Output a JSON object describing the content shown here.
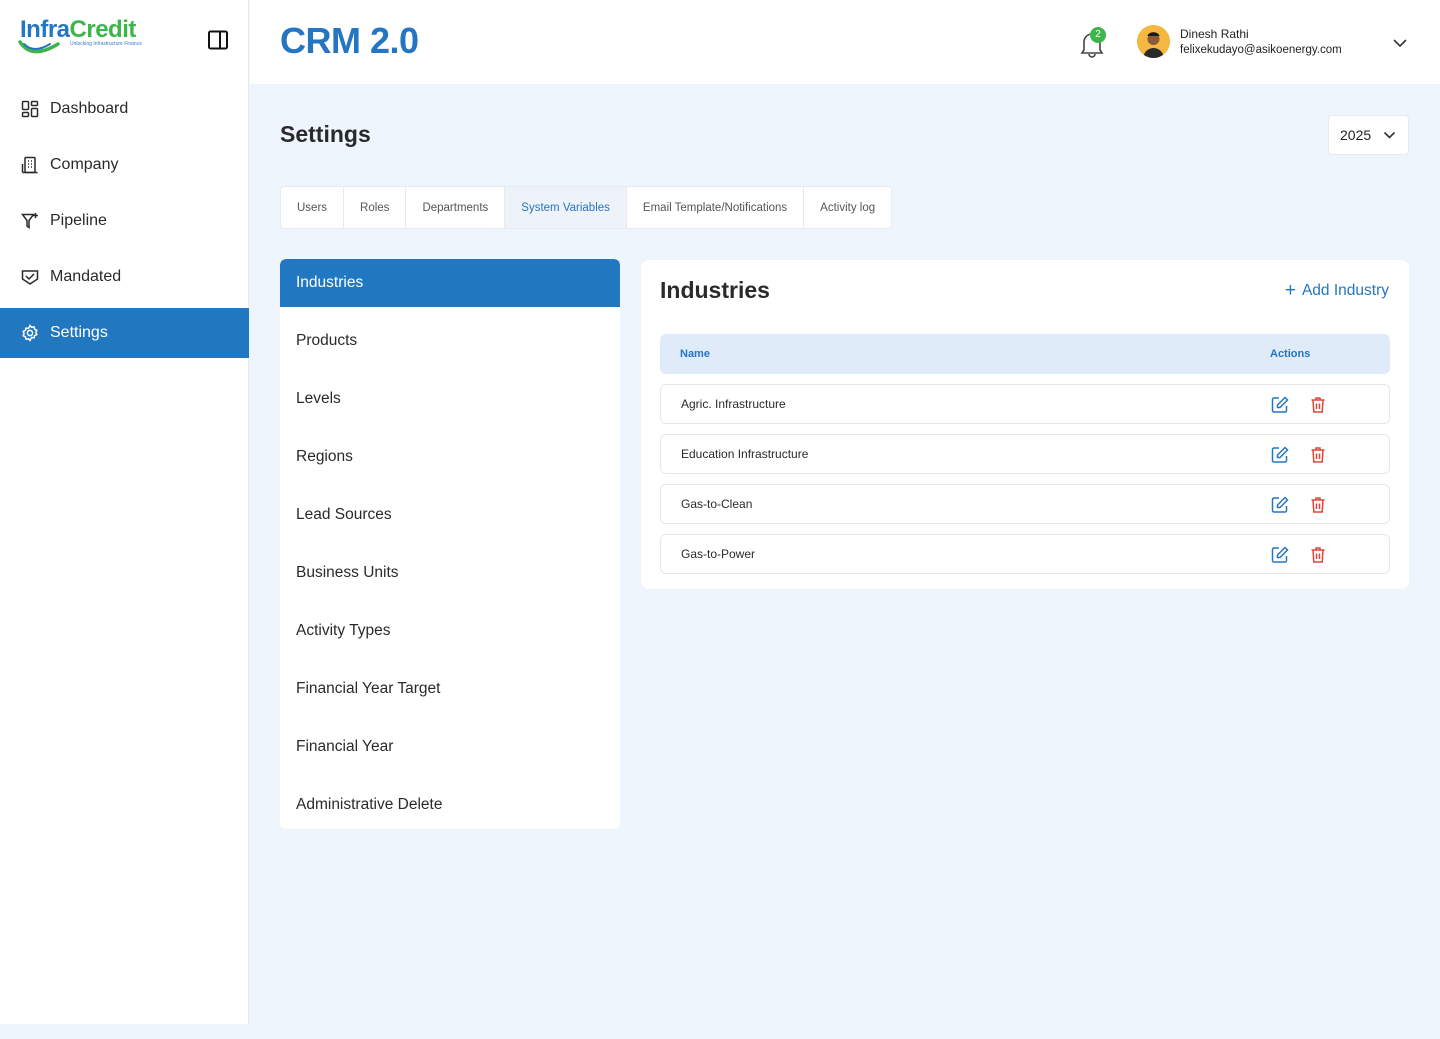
{
  "brand": {
    "logo_part1": "Infra",
    "logo_part2": "Credit",
    "logo_tagline": "Unlocking Infrastructure Finance",
    "app_title": "CRM 2.0",
    "primary_color": "#2476c2",
    "accent_color": "#3db54a"
  },
  "sidebar": {
    "items": [
      {
        "label": "Dashboard",
        "icon": "dashboard-icon"
      },
      {
        "label": "Company",
        "icon": "building-icon"
      },
      {
        "label": "Pipeline",
        "icon": "funnel-icon"
      },
      {
        "label": "Mandated",
        "icon": "handshake-icon"
      },
      {
        "label": "Settings",
        "icon": "gear-icon",
        "active": true
      }
    ]
  },
  "header": {
    "notifications_count": "2",
    "user_name": "Dinesh Rathi",
    "user_email": "felixekudayo@asikoenergy.com"
  },
  "page": {
    "title": "Settings",
    "year": "2025"
  },
  "tabs": [
    {
      "label": "Users"
    },
    {
      "label": "Roles"
    },
    {
      "label": "Departments"
    },
    {
      "label": "System Variables",
      "active": true
    },
    {
      "label": "Email Template/Notifications"
    },
    {
      "label": "Activity log"
    }
  ],
  "variables": [
    {
      "label": "Industries",
      "active": true
    },
    {
      "label": "Products"
    },
    {
      "label": "Levels"
    },
    {
      "label": "Regions"
    },
    {
      "label": "Lead Sources"
    },
    {
      "label": "Business Units"
    },
    {
      "label": "Activity Types"
    },
    {
      "label": "Financial Year Target"
    },
    {
      "label": "Financial Year"
    },
    {
      "label": "Administrative Delete"
    }
  ],
  "panel": {
    "title": "Industries",
    "add_label": "Add Industry",
    "columns": {
      "name": "Name",
      "actions": "Actions"
    },
    "rows": [
      {
        "name": "Agric. Infrastructure"
      },
      {
        "name": "Education Infrastructure"
      },
      {
        "name": "Gas-to-Clean"
      },
      {
        "name": "Gas-to-Power"
      }
    ]
  }
}
